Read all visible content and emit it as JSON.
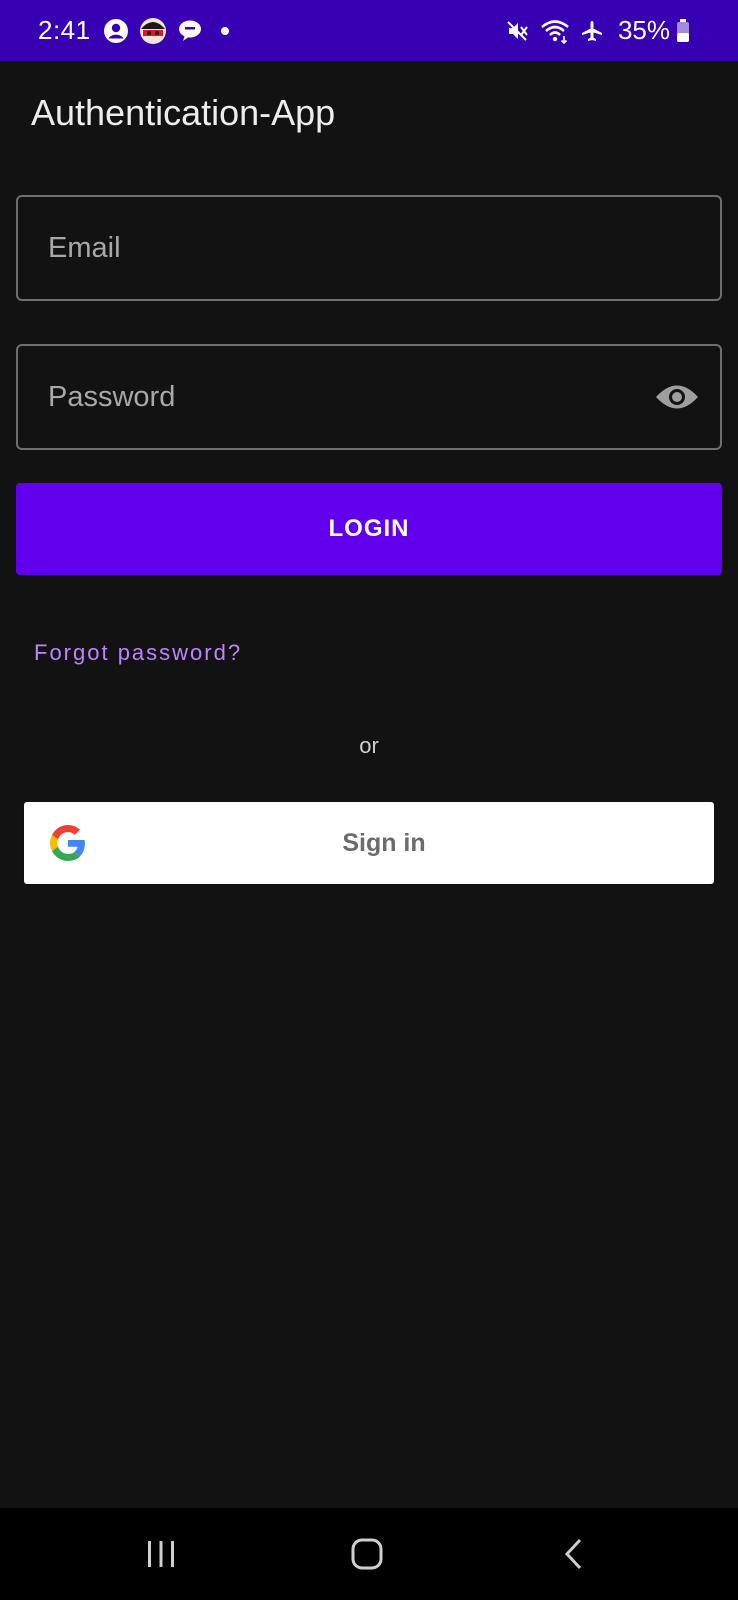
{
  "status_bar": {
    "time": "2:41",
    "battery_percent": "35%",
    "icons": [
      "account-circle-icon",
      "app-avatar-icon",
      "chat-bubble-icon",
      "notification-dot",
      "mute-icon",
      "wifi-icon",
      "airplane-icon",
      "battery-icon"
    ]
  },
  "app": {
    "title": "Authentication-App"
  },
  "form": {
    "email_placeholder": "Email",
    "email_value": "",
    "password_placeholder": "Password",
    "password_value": "",
    "password_toggle_icon": "eye-icon",
    "login_label": "LOGIN",
    "forgot_label": "Forgot password?",
    "separator_label": "or",
    "google_label": "Sign in",
    "google_icon": "google-logo-icon"
  },
  "nav_bar": {
    "buttons": [
      "recents",
      "home",
      "back"
    ]
  },
  "colors": {
    "status_bar": "#3700b3",
    "primary": "#6200ee",
    "accent_text": "#bb86fc",
    "background": "#121212"
  }
}
